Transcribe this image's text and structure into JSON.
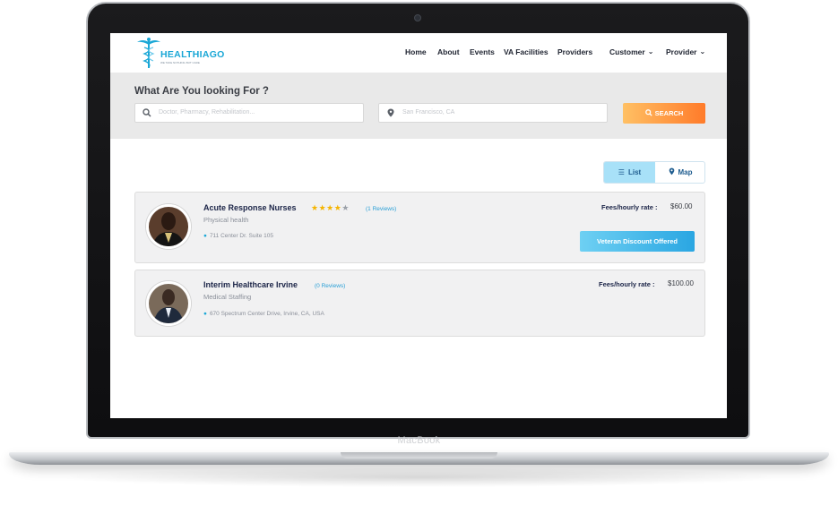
{
  "device": {
    "brand_label": "MacBook"
  },
  "navbar": {
    "logo_text": "HEALTHIAGO",
    "logo_tagline": "WE TAKE NOTHING BUT CARE",
    "items": [
      {
        "label": "Home"
      },
      {
        "label": "About"
      },
      {
        "label": "Events"
      },
      {
        "label": "VA Facilities"
      },
      {
        "label": "Providers"
      },
      {
        "label": "Customer"
      },
      {
        "label": "Provider"
      }
    ]
  },
  "search": {
    "title": "What Are You looking For ?",
    "keyword_placeholder": "Doctor, Pharmacy, Rehabilitation...",
    "location_placeholder": "San Francisco, CA",
    "button_label": "SEARCH"
  },
  "view_toggle": {
    "list_label": "List",
    "map_label": "Map",
    "active": "List"
  },
  "results": [
    {
      "name": "Acute Response Nurses",
      "rating": 4,
      "max_rating": 5,
      "reviews": "(1 Reviews)",
      "category": "Physical health",
      "address": "711 Center Dr. Suite 105",
      "fee_label": "Fees/hourly rate :",
      "fee_value": "$60.00",
      "badge": "Veteran Discount Offered"
    },
    {
      "name": "Interim Healthcare Irvine",
      "reviews": "(0 Reviews)",
      "category": "Medical Staffing",
      "address": "670 Spectrum Center Drive, Irvine, CA, USA",
      "fee_label": "Fees/hourly rate :",
      "fee_value": "$100.00"
    }
  ],
  "colors": {
    "accent_blue": "#1aa7d6",
    "search_gradient_start": "#ffc064",
    "search_gradient_end": "#ff7b2a",
    "star": "#f5b400",
    "name_navy": "#1b2447"
  }
}
